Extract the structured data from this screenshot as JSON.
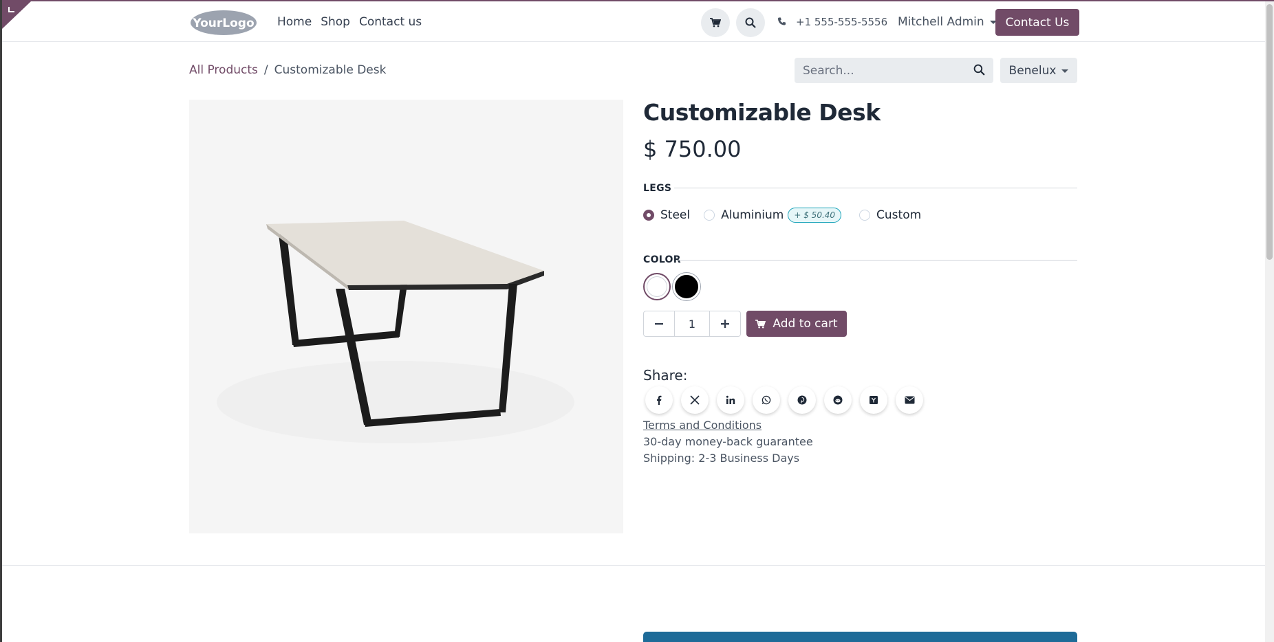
{
  "header": {
    "logo_text": "YourLogo",
    "nav": [
      "Home",
      "Shop",
      "Contact us"
    ],
    "phone": "+1 555-555-5556",
    "user_name": "Mitchell Admin",
    "cta_label": "Contact Us"
  },
  "breadcrumb": {
    "parent": "All Products",
    "separator": "/",
    "current": "Customizable Desk"
  },
  "search": {
    "placeholder": "Search..."
  },
  "region": {
    "label": "Benelux"
  },
  "product": {
    "name": "Customizable Desk",
    "price": "$ 750.00",
    "attributes": {
      "legs": {
        "title": "LEGS",
        "options": [
          {
            "label": "Steel",
            "selected": true
          },
          {
            "label": "Aluminium",
            "extra": "+ $ 50.40",
            "selected": false
          },
          {
            "label": "Custom",
            "selected": false
          }
        ]
      },
      "color": {
        "title": "COLOR",
        "options": [
          {
            "name": "White",
            "hex": "#ffffff",
            "selected": true
          },
          {
            "name": "Black",
            "hex": "#000000",
            "selected": false
          }
        ]
      }
    },
    "quantity": "1",
    "add_to_cart": "Add to cart"
  },
  "share": {
    "label": "Share:",
    "networks": [
      "facebook-icon",
      "x-icon",
      "linkedin-icon",
      "whatsapp-icon",
      "pinterest-icon",
      "reddit-icon",
      "hacker-news-icon",
      "email-icon"
    ]
  },
  "info": {
    "terms": "Terms and Conditions",
    "guarantee": "30-day money-back guarantee",
    "shipping": "Shipping: 2-3 Business Days"
  },
  "colors": {
    "brand": "#714b67",
    "badge_border": "#17a2b8",
    "footer_block": "#1e6b98"
  }
}
